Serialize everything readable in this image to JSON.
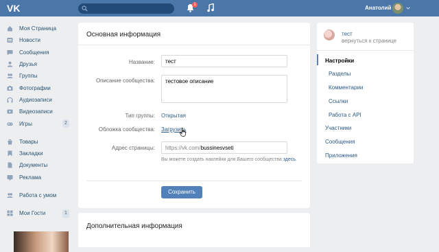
{
  "header": {
    "user_name": "Анатолий",
    "bell_badge": "1",
    "search_placeholder": ""
  },
  "sidebar": {
    "items": [
      {
        "label": "Моя Страница",
        "icon": "home-icon"
      },
      {
        "label": "Новости",
        "icon": "news-icon"
      },
      {
        "label": "Сообщения",
        "icon": "messages-icon"
      },
      {
        "label": "Друзья",
        "icon": "friends-icon"
      },
      {
        "label": "Группы",
        "icon": "groups-icon"
      },
      {
        "label": "Фотографии",
        "icon": "camera-icon"
      },
      {
        "label": "Аудиозаписи",
        "icon": "music-icon"
      },
      {
        "label": "Видеозаписи",
        "icon": "video-icon"
      },
      {
        "label": "Игры",
        "icon": "games-icon",
        "count": "2"
      }
    ],
    "items2": [
      {
        "label": "Товары",
        "icon": "goods-icon"
      },
      {
        "label": "Закладки",
        "icon": "bookmark-icon"
      },
      {
        "label": "Документы",
        "icon": "document-icon"
      },
      {
        "label": "Реклама",
        "icon": "ads-icon"
      }
    ],
    "items3": [
      {
        "label": "Работа с умом",
        "icon": "community-icon"
      }
    ],
    "items4": [
      {
        "label": "Мои Гости",
        "icon": "guests-icon",
        "count": "1"
      }
    ]
  },
  "main": {
    "title": "Основная информация",
    "name_label": "Название:",
    "name_value": "тест",
    "description_label": "Описание сообщества:",
    "description_value": "тестовое описание",
    "group_type_label": "Тип группы:",
    "group_type_value": "Открытая",
    "cover_label": "Обложка сообщества:",
    "cover_link": "Загрузить",
    "address_label": "Адрес страницы:",
    "address_prefix": "https://vk.com/",
    "address_value": "bussinesvseti",
    "hint_text": "Вы можете создать наклейки для Вашего сообщества",
    "hint_link": "здесь",
    "hint_end": ".",
    "save_button": "Сохранить"
  },
  "main2": {
    "title": "Дополнительная информация"
  },
  "right_panel": {
    "group_name": "тест",
    "back_link": "вернуться к странице",
    "menu": [
      {
        "label": "Настройки",
        "active": true
      },
      {
        "label": "Разделы",
        "sub": true
      },
      {
        "label": "Комментарии",
        "sub": true
      },
      {
        "label": "Ссылки",
        "sub": true
      },
      {
        "label": "Работа с API",
        "sub": true
      },
      {
        "label": "Участники"
      },
      {
        "label": "Сообщения"
      },
      {
        "label": "Приложения"
      }
    ]
  },
  "colors": {
    "header": "#4a76a8",
    "link": "#2a5885",
    "button": "#5181b8",
    "background": "#edeef0"
  }
}
